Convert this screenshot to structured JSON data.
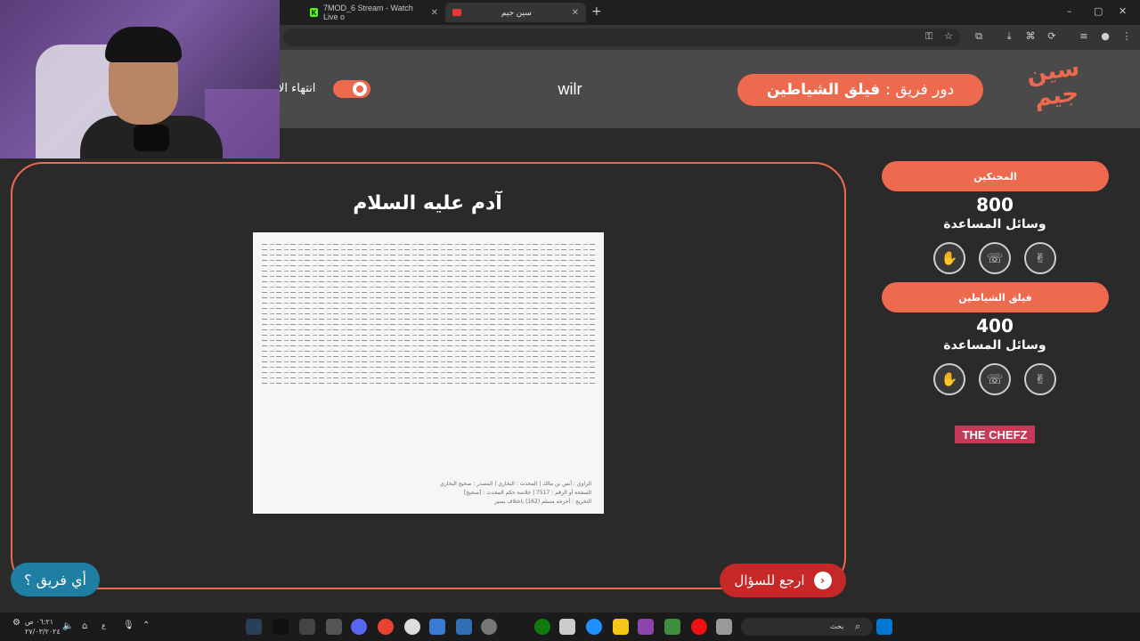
{
  "browser": {
    "tabs": [
      {
        "label": "7MOD_6 Stream - Watch Live o"
      },
      {
        "label": "سين جيم"
      }
    ],
    "new_tab": "+",
    "window_controls": {
      "minimize": "–",
      "maximize": "▢",
      "close": "✕"
    }
  },
  "header": {
    "logo_text": "سين جيم",
    "turn_prefix": "دور فريق :",
    "turn_team": "فيلق الشياطين",
    "player_name": "wilr",
    "end_label": "انتهاء الا"
  },
  "question": {
    "title": "آدم عليه السلام",
    "doc_footer_1": "الراوي : أنس بن مالك | المحدث : البخاري | المصدر : صحيح البخاري",
    "doc_footer_2": "الصفحة أو الرقم : 7517 | خلاصة حكم المحدث : [صحيح]",
    "doc_footer_3": "التخريج : أخرجه مسلم (162) باختلاف يسير"
  },
  "buttons": {
    "back": "ارجع للسؤال",
    "back_icon": "‹",
    "which_team": "أي فريق ؟"
  },
  "teams": [
    {
      "name": "المحنكين",
      "score": "800",
      "aids_label": "وسائل المساعدة"
    },
    {
      "name": "فيلق الشياطين",
      "score": "400",
      "aids_label": "وسائل المساعدة"
    }
  ],
  "aids_icons": [
    "hand-stop-icon",
    "phone-icon",
    "peace-hand-icon"
  ],
  "sponsor": "THE CHEFZ",
  "taskbar": {
    "search_placeholder": "بحث",
    "time": "٠٦:٢١ ص",
    "date": "٢٧/٠٣/٢٠٢٤",
    "lang": "ع"
  },
  "colors": {
    "accent": "#ee6a4f",
    "back_button": "#c62828",
    "which_button": "#1e7fa3",
    "sponsor": "#c73a57"
  }
}
